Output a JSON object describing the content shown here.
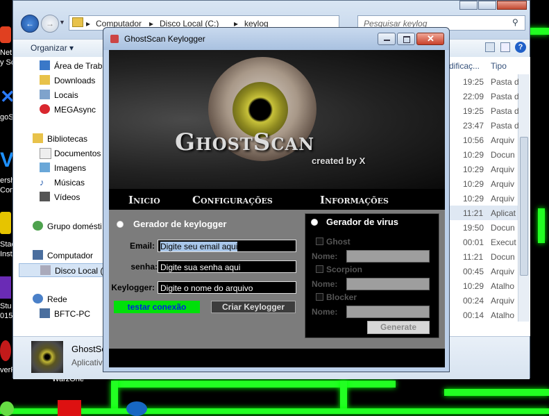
{
  "desktop": {
    "left_labels": [
      "Net",
      "y Sc",
      "goS",
      "ersh",
      "Conv",
      "Stac",
      "Insta",
      "Stu",
      "015",
      "verR"
    ],
    "bottom_label": "WarzOne"
  },
  "explorer": {
    "address": {
      "part1": "Computador",
      "part2": "Disco Local (C:)",
      "part3": "keylog"
    },
    "search_placeholder": "Pesquisar keylog",
    "toolbar": {
      "organize": "Organizar"
    },
    "sidebar": [
      {
        "label": "Área de Trabal"
      },
      {
        "label": "Downloads"
      },
      {
        "label": "Locais"
      },
      {
        "label": "MEGAsync"
      },
      {
        "label": "Bibliotecas"
      },
      {
        "label": "Documentos"
      },
      {
        "label": "Imagens"
      },
      {
        "label": "Músicas"
      },
      {
        "label": "Vídeos"
      },
      {
        "label": "Grupo domésti"
      },
      {
        "label": "Computador"
      },
      {
        "label": "Disco Local (C"
      },
      {
        "label": "Rede"
      },
      {
        "label": "BFTC-PC"
      }
    ],
    "columns": {
      "modified": "dificaç...",
      "type": "Tipo"
    },
    "rows": [
      {
        "time": "19:25",
        "type": "Pasta d"
      },
      {
        "time": "22:09",
        "type": "Pasta d"
      },
      {
        "time": "19:25",
        "type": "Pasta d"
      },
      {
        "time": "23:47",
        "type": "Pasta d"
      },
      {
        "time": "10:56",
        "type": "Arquiv"
      },
      {
        "time": "10:29",
        "type": "Docun"
      },
      {
        "time": "10:29",
        "type": "Arquiv"
      },
      {
        "time": "10:29",
        "type": "Arquiv"
      },
      {
        "time": "10:29",
        "type": "Arquiv"
      },
      {
        "time": "11:21",
        "type": "Aplicat"
      },
      {
        "time": "19:50",
        "type": "Docun"
      },
      {
        "time": "00:01",
        "type": "Execut"
      },
      {
        "time": "11:21",
        "type": "Docun"
      },
      {
        "time": "00:45",
        "type": "Arquiv"
      },
      {
        "time": "10:29",
        "type": "Atalho"
      },
      {
        "time": "00:24",
        "type": "Arquiv"
      },
      {
        "time": "00:14",
        "type": "Atalho"
      }
    ],
    "details": {
      "name": "GhostSca",
      "type": "Aplicativ"
    }
  },
  "keylogger": {
    "title": "GhostScan Keylogger",
    "logo": "GhostScan",
    "created_by": "created by X",
    "nav": [
      "Inicio",
      "Configurações",
      "Informações"
    ],
    "keylogger_panel": {
      "title": "Gerador de keylogger",
      "email_label": "Email:",
      "email_value": "Digite seu email aqui",
      "senha_label": "senha:",
      "senha_value": "Digite sua senha aqui",
      "keylogger_label": "Keylogger:",
      "keylogger_value": "Digite o nome do arquivo",
      "test_button": "testar conexão",
      "create_button": "Criar Keylogger"
    },
    "virus_panel": {
      "title": "Gerador de virus",
      "options": [
        {
          "check_label": "Ghost",
          "name_label": "Nome:"
        },
        {
          "check_label": "Scorpion",
          "name_label": "Nome:"
        },
        {
          "check_label": "Blocker",
          "name_label": "Nome:"
        }
      ],
      "generate_button": "Generate"
    }
  },
  "colors": {
    "neon": "#22ff22",
    "test_button_bg": "#00e00a",
    "test_button_text": "#0020e0"
  }
}
